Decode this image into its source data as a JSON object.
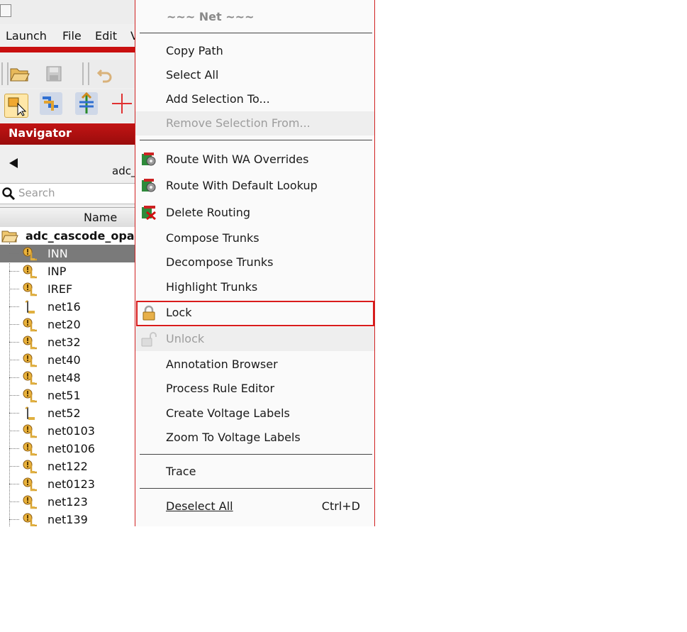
{
  "menubar": {
    "launch": "Launch",
    "file": "File",
    "edit": "Edit",
    "view_partial": "V"
  },
  "navigator": {
    "title": "Navigator",
    "breadcrumb": "adc_",
    "search_placeholder": "Search",
    "column_name": "Name",
    "root": "adc_cascode_opam",
    "items": [
      {
        "label": "INN",
        "icon": "net-warning-icon",
        "selected": true
      },
      {
        "label": "INP",
        "icon": "net-warning-icon"
      },
      {
        "label": "IREF",
        "icon": "net-warning-icon"
      },
      {
        "label": "net16",
        "icon": "net-plain-icon"
      },
      {
        "label": "net20",
        "icon": "net-warning-icon"
      },
      {
        "label": "net32",
        "icon": "net-warning-icon"
      },
      {
        "label": "net40",
        "icon": "net-warning-icon"
      },
      {
        "label": "net48",
        "icon": "net-warning-icon"
      },
      {
        "label": "net51",
        "icon": "net-warning-icon"
      },
      {
        "label": "net52",
        "icon": "net-plain-icon"
      },
      {
        "label": "net0103",
        "icon": "net-warning-icon"
      },
      {
        "label": "net0106",
        "icon": "net-warning-icon"
      },
      {
        "label": "net122",
        "icon": "net-warning-icon"
      },
      {
        "label": "net0123",
        "icon": "net-warning-icon"
      },
      {
        "label": "net123",
        "icon": "net-warning-icon"
      },
      {
        "label": "net139",
        "icon": "net-warning-icon"
      }
    ]
  },
  "context_menu": {
    "header": "~~~ Net ~~~",
    "items": {
      "copy_path": "Copy Path",
      "select_all": "Select All",
      "add_selection_to": "Add Selection To...",
      "remove_selection_from": "Remove Selection From...",
      "route_wa": "Route With WA Overrides",
      "route_default": "Route With Default Lookup",
      "delete_routing": "Delete Routing",
      "compose_trunks": "Compose Trunks",
      "decompose_trunks": "Decompose Trunks",
      "highlight_trunks": "Highlight Trunks",
      "lock": "Lock",
      "unlock": "Unlock",
      "annotation_browser": "Annotation Browser",
      "process_rule_editor": "Process Rule Editor",
      "create_voltage_labels": "Create Voltage Labels",
      "zoom_voltage_labels": "Zoom To Voltage Labels",
      "trace": "Trace",
      "deselect_all": "Deselect All",
      "deselect_all_shortcut": "Ctrl+D"
    }
  },
  "colors": {
    "accent_red": "#c91010",
    "highlight_border": "#d91c1c",
    "selected_row": "#7a7a7a",
    "disabled_text": "#9d9d9d"
  }
}
